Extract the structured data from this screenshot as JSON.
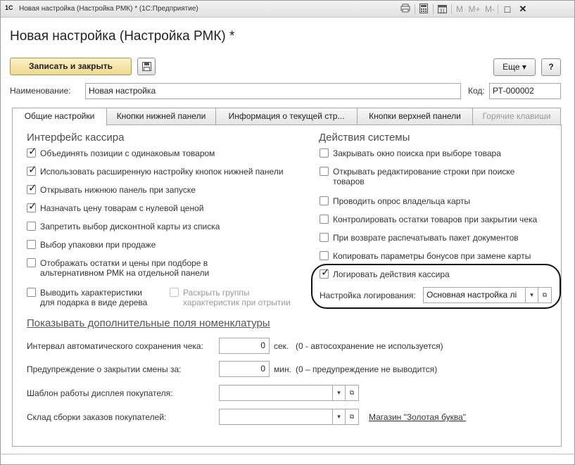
{
  "window": {
    "title": "Новая настройка (Настройка РМК) * (1С:Предприятие)",
    "logo_text": "1С",
    "toolbar_icons": [
      "print-icon",
      "calculator-icon",
      "calendar-icon",
      "m-button",
      "m-plus-button",
      "m-minus-button",
      "maximize-icon",
      "close-icon"
    ],
    "memory_labels": [
      "M",
      "M+",
      "M-"
    ],
    "maximize_glyph": "□",
    "close_glyph": "✕"
  },
  "page_title": "Новая настройка (Настройка РМК) *",
  "toolbar": {
    "save_close": "Записать и закрыть",
    "save_icon": "floppy-icon",
    "more": "Еще ▾",
    "help": "?"
  },
  "name_field": {
    "label": "Наименование:",
    "value": "Новая настройка"
  },
  "code_field": {
    "label": "Код:",
    "value": "РТ-000002"
  },
  "tabs": [
    {
      "label": "Общие настройки",
      "active": true
    },
    {
      "label": "Кнопки нижней панели",
      "active": false
    },
    {
      "label": "Информация о текущей стр...",
      "active": false
    },
    {
      "label": "Кнопки верхней панели",
      "active": false
    },
    {
      "label": "Горячие клавиши",
      "disabled": true
    }
  ],
  "left_group": {
    "title": "Интерфейс кассира",
    "items": [
      {
        "label": "Объединять позиции с одинаковым товаром",
        "checked": true
      },
      {
        "label": "Использовать расширенную настройку кнопок нижней панели",
        "checked": true
      },
      {
        "label": "Открывать нижнюю панель при запуске",
        "checked": true
      },
      {
        "label": "Назначать цену товарам с нулевой ценой",
        "checked": true
      },
      {
        "label": "Запретить выбор дисконтной карты из списка",
        "checked": false
      },
      {
        "label": "Выбор упаковки при продаже",
        "checked": false
      },
      {
        "label_line1": "Отображать остатки и цены при подборе в",
        "label_line2": "альтернативном РМК на отдельной панели",
        "checked": false
      },
      {
        "label_line1": "Выводить характеристики",
        "label_line2": "для подарка в виде дерева",
        "checked": false
      },
      {
        "label_line1": "Раскрыть группы",
        "label_line2": "характеристик при отрытии",
        "checked": false,
        "disabled": true
      }
    ]
  },
  "right_group": {
    "title": "Действия системы",
    "items": [
      {
        "label": "Закрывать окно поиска при выборе товара",
        "checked": false
      },
      {
        "label_line1": "Открывать редактирование строки при поиске",
        "label_line2": "товаров",
        "checked": false
      },
      {
        "label": "Проводить опрос владельца карты",
        "checked": false
      },
      {
        "label": "Контролировать остатки товаров при закрытии чека",
        "checked": false
      },
      {
        "label": "При возврате распечатывать пакет документов",
        "checked": false
      },
      {
        "label": "Копировать параметры бонусов при замене карты",
        "checked": false
      },
      {
        "label": "Логировать действия кассира",
        "checked": true
      }
    ],
    "logging_setting": {
      "label": "Настройка логирования:",
      "value": "Основная настройка лі"
    }
  },
  "extra_fields_link": "Показывать дополнительные поля номенклатуры",
  "form_rows": [
    {
      "label": "Интервал автоматического сохранения чека:",
      "value": "0",
      "unit": "сек.",
      "hint": "(0 - автосохранение не используется)"
    },
    {
      "label": "Предупреждение о закрытии смены за:",
      "value": "0",
      "unit": "мин.",
      "hint": "(0 – предупреждение не выводится)"
    },
    {
      "label": "Шаблон работы дисплея покупателя:",
      "value": ""
    },
    {
      "label": "Склад сборки заказов покупателей:",
      "value": "",
      "link": "Магазин \"Золотая буква\""
    }
  ],
  "glyphs": {
    "check": "✓",
    "dropdown": "▾",
    "open": "⧉"
  },
  "colors": {
    "title_gradient_top": "#f4f4f4",
    "primary_button": "#efd98e",
    "border": "#a8a8a8"
  }
}
